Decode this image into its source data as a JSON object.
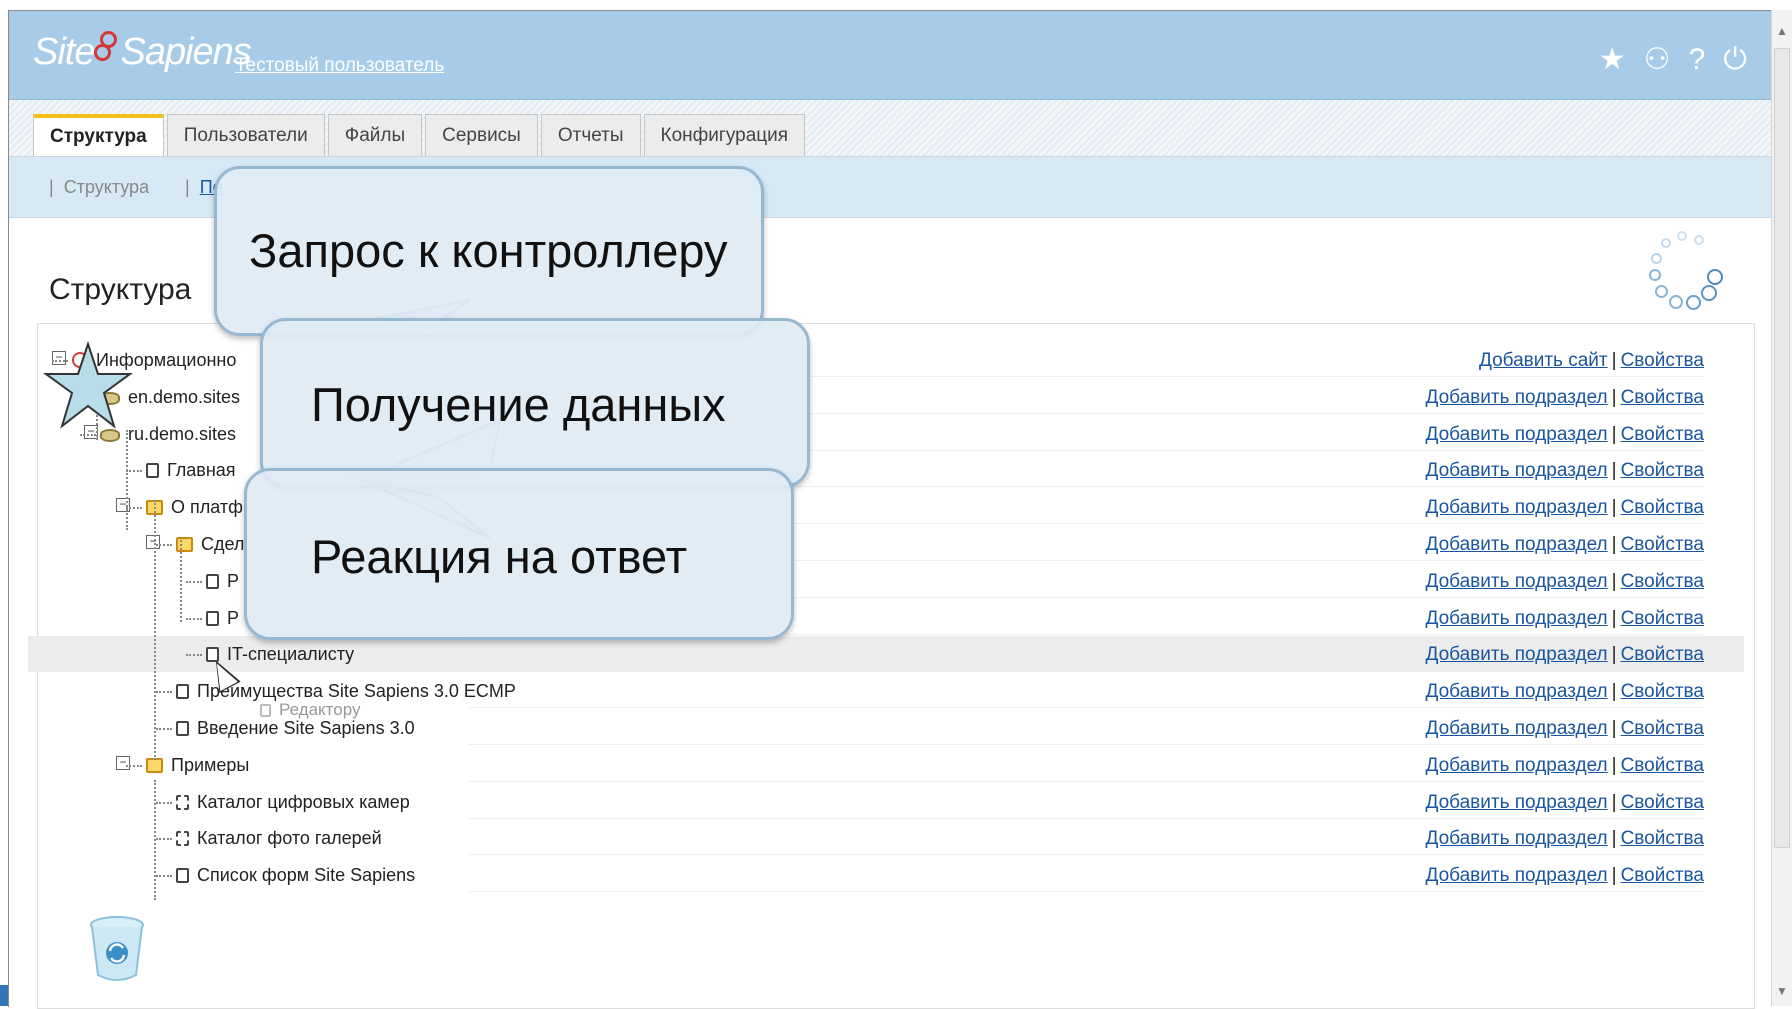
{
  "header": {
    "logo_left": "Site",
    "logo_right": "Sapiens",
    "user_link": "Тестовый пользователь",
    "icons": [
      "star-icon",
      "network-icon",
      "help-icon",
      "power-icon"
    ],
    "icon_glyphs": [
      "★",
      "⚇",
      "?",
      "⏻"
    ]
  },
  "tabs": [
    {
      "label": "Структура",
      "active": true
    },
    {
      "label": "Пользователи"
    },
    {
      "label": "Файлы"
    },
    {
      "label": "Сервисы"
    },
    {
      "label": "Отчеты"
    },
    {
      "label": "Конфигурация"
    }
  ],
  "subnav": {
    "item1": "Структура",
    "item2": "Пе"
  },
  "page": {
    "title": "Структура"
  },
  "tree": {
    "action_add_site": "Добавить сайт",
    "action_add_subsection": "Добавить подраздел",
    "action_properties": "Свойства",
    "separator": "|",
    "rows": [
      {
        "label": "Информационно",
        "icon": "root-icon"
      },
      {
        "label": "en.demo.sites",
        "icon": "site-icon"
      },
      {
        "label": "ru.demo.sites",
        "icon": "site-icon"
      },
      {
        "label": "Главная",
        "icon": "page-icon"
      },
      {
        "label": "О платф",
        "icon": "folder-icon"
      },
      {
        "label": "Сдел",
        "icon": "folder-icon"
      },
      {
        "label": "Р",
        "icon": "page-icon"
      },
      {
        "label": "Р",
        "icon": "page-icon"
      },
      {
        "label": "IT-специалисту",
        "icon": "page-icon",
        "highlighted": true
      },
      {
        "label": "Преимущества Site Sapiens 3.0 ECMP",
        "icon": "page-icon"
      },
      {
        "label": "Введение Site Sapiens 3.0",
        "icon": "page-icon"
      },
      {
        "label": "Примеры",
        "icon": "folder-icon"
      },
      {
        "label": "Каталог цифровых камер",
        "icon": "form-icon"
      },
      {
        "label": "Каталог фото галерей",
        "icon": "form-icon"
      },
      {
        "label": "Список форм Site Sapiens",
        "icon": "page-icon"
      }
    ],
    "drag_ghost": "Редактору"
  },
  "callouts": {
    "request": "Запрос к контроллеру",
    "receive": "Получение данных",
    "reaction": "Реакция на ответ"
  },
  "colors": {
    "header_bg": "#a8cce8",
    "subnav_bg": "#d8e9f6",
    "link": "#1a56a0",
    "active_tab_accent": "#f2c01a",
    "logo_rings": "#d43838",
    "callout_fill": "#dfeaf4",
    "callout_border": "#98b8d0"
  }
}
